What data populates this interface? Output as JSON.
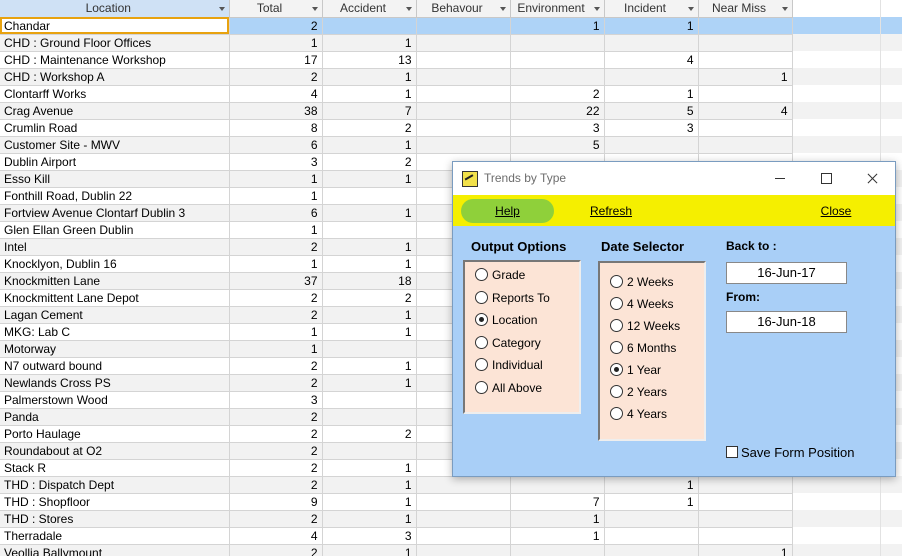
{
  "columns": [
    "Location",
    "Total",
    "Accident",
    "Behavour",
    "Environment",
    "Incident",
    "Near Miss"
  ],
  "rows": [
    [
      "Chandar",
      "2",
      "",
      "",
      "1",
      "1",
      ""
    ],
    [
      "CHD : Ground Floor Offices",
      "1",
      "1",
      "",
      "",
      "",
      ""
    ],
    [
      "CHD : Maintenance Workshop",
      "17",
      "13",
      "",
      "",
      "4",
      ""
    ],
    [
      "CHD : Workshop A",
      "2",
      "1",
      "",
      "",
      "",
      "1"
    ],
    [
      "Clontarff Works",
      "4",
      "1",
      "",
      "2",
      "1",
      ""
    ],
    [
      "Crag Avenue",
      "38",
      "7",
      "",
      "22",
      "5",
      "4"
    ],
    [
      "Crumlin Road",
      "8",
      "2",
      "",
      "3",
      "3",
      ""
    ],
    [
      "Customer Site - MWV",
      "6",
      "1",
      "",
      "5",
      "",
      ""
    ],
    [
      "Dublin Airport",
      "3",
      "2",
      "",
      "",
      "",
      ""
    ],
    [
      "Esso Kill",
      "1",
      "1",
      "",
      "",
      "",
      ""
    ],
    [
      "Fonthill Road, Dublin 22",
      "1",
      "",
      "",
      "",
      "",
      ""
    ],
    [
      "Fortview Avenue Clontarf Dublin 3",
      "6",
      "1",
      "",
      "",
      "",
      ""
    ],
    [
      "Glen Ellan Green Dublin",
      "1",
      "",
      "",
      "",
      "",
      ""
    ],
    [
      "Intel",
      "2",
      "1",
      "",
      "",
      "",
      ""
    ],
    [
      "Knocklyon, Dublin 16",
      "1",
      "1",
      "",
      "",
      "",
      ""
    ],
    [
      "Knockmitten Lane",
      "37",
      "18",
      "",
      "",
      "",
      ""
    ],
    [
      "Knockmittent Lane Depot",
      "2",
      "2",
      "",
      "",
      "",
      ""
    ],
    [
      "Lagan Cement",
      "2",
      "1",
      "",
      "",
      "",
      ""
    ],
    [
      "MKG: Lab C",
      "1",
      "1",
      "",
      "",
      "",
      ""
    ],
    [
      "Motorway",
      "1",
      "",
      "",
      "",
      "",
      ""
    ],
    [
      "N7 outward bound",
      "2",
      "1",
      "",
      "",
      "",
      ""
    ],
    [
      "Newlands Cross PS",
      "2",
      "1",
      "",
      "",
      "",
      ""
    ],
    [
      "Palmerstown Wood",
      "3",
      "",
      "",
      "",
      "",
      ""
    ],
    [
      "Panda",
      "2",
      "",
      "",
      "",
      "",
      ""
    ],
    [
      "Porto Haulage",
      "2",
      "2",
      "",
      "",
      "",
      ""
    ],
    [
      "Roundabout at O2",
      "2",
      "",
      "",
      "",
      "",
      ""
    ],
    [
      "Stack R",
      "2",
      "1",
      "",
      "",
      "",
      ""
    ],
    [
      "THD : Dispatch Dept",
      "2",
      "1",
      "",
      "",
      "1",
      ""
    ],
    [
      "THD : Shopfloor",
      "9",
      "1",
      "",
      "7",
      "1",
      ""
    ],
    [
      "THD : Stores",
      "2",
      "1",
      "",
      "1",
      "",
      ""
    ],
    [
      "Therradale",
      "4",
      "3",
      "",
      "1",
      "",
      ""
    ],
    [
      "Veollia Ballymount",
      "2",
      "1",
      "",
      "",
      "",
      "1"
    ]
  ],
  "dialog": {
    "title": "Trends by Type",
    "help": "Help",
    "refresh": "Refresh",
    "close": "Close",
    "output_title": "Output Options",
    "output_options": [
      "Grade",
      "Reports To",
      "Location",
      "Category",
      "Individual",
      "All Above"
    ],
    "output_selected": "Location",
    "date_title": "Date Selector",
    "date_options": [
      "2  Weeks",
      "4  Weeks",
      "12 Weeks",
      "6 Months",
      "1 Year",
      "2 Years",
      "4 Years"
    ],
    "date_selected": "1 Year",
    "back_to_label": "Back to :",
    "back_to_value": "16-Jun-17",
    "from_label": "From:",
    "from_value": "16-Jun-18",
    "save_position_label": "Save Form Position",
    "save_position_checked": false
  }
}
